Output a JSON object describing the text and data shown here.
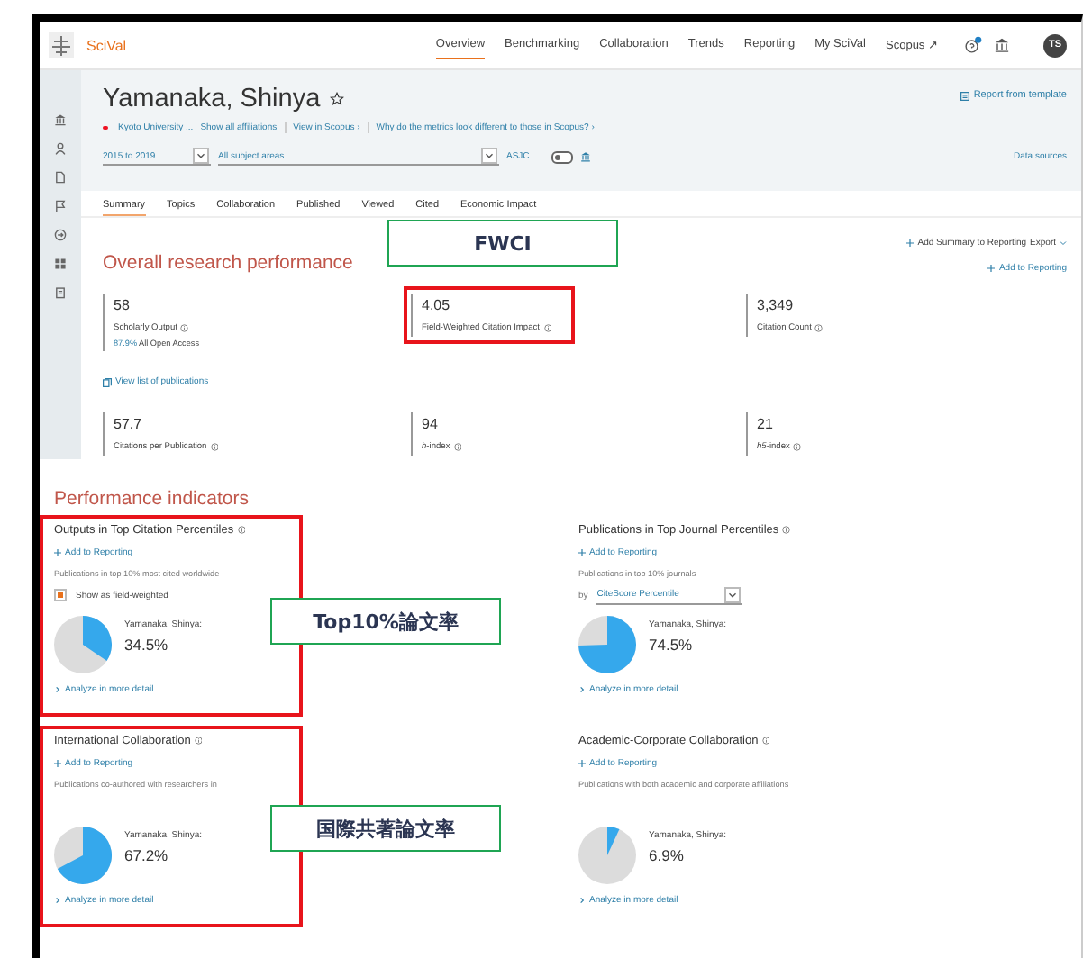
{
  "nav": {
    "logo": "SciVal",
    "items": [
      {
        "label": "Overview",
        "selected": true
      },
      {
        "label": "Benchmarking",
        "selected": false
      },
      {
        "label": "Collaboration",
        "selected": false
      },
      {
        "label": "Trends",
        "selected": false
      },
      {
        "label": "Reporting",
        "selected": false
      },
      {
        "label": "My SciVal",
        "selected": false
      },
      {
        "label": "Scopus ↗",
        "selected": false
      }
    ],
    "avatar": "TS"
  },
  "profile": {
    "name": "Yamanaka, Shinya",
    "favorite": false,
    "links": [
      "Kyoto University ...",
      "Show all affiliations",
      "View in Scopus ›",
      "Why do the metrics look different to those in Scopus? ›"
    ],
    "report": "Report from template"
  },
  "filters": {
    "years": "2015 to 2019",
    "subject": "All subject areas",
    "classification": "ASJC",
    "toggle_on": false,
    "data_sources": "Data sources"
  },
  "tabs": [
    {
      "label": "Summary",
      "selected": true
    },
    {
      "label": "Topics",
      "selected": false
    },
    {
      "label": "Collaboration",
      "selected": false
    },
    {
      "label": "Published",
      "selected": false
    },
    {
      "label": "Viewed",
      "selected": false
    },
    {
      "label": "Cited",
      "selected": false
    },
    {
      "label": "Economic Impact",
      "selected": false
    }
  ],
  "overall": {
    "title": "Overall research performance",
    "add_summary": "Add Summary to Reporting",
    "export": "Export",
    "add": "Add to Reporting",
    "view_list": "View list of publications",
    "metrics": [
      {
        "value": "58",
        "label": "Scholarly Output",
        "highlighted": false,
        "note_value": "87.9%",
        "note": "All Open Access"
      },
      {
        "value": "4.05",
        "label": "Field-Weighted Citation Impact",
        "highlighted": true
      },
      {
        "value": "3,349",
        "label": "Citation Count",
        "highlighted": false
      },
      {
        "value": "57.7",
        "label": "Citations per Publication",
        "highlighted": false
      },
      {
        "value": "94",
        "label": "*h*-index",
        "highlighted": false
      },
      {
        "value": "21",
        "label": "*h5*-index",
        "highlighted": false
      }
    ]
  },
  "indicators": {
    "title": "Performance indicators",
    "cards": [
      {
        "title": "Outputs in Top Citation Percentiles",
        "add": "Add to Reporting",
        "description": "Publications in top 10% most cited worldwide",
        "kind": "checkbox",
        "option": {
          "label": "Show as field-weighted",
          "checked": true
        },
        "entity": "Yamanaka, Shinya:",
        "value": "34.5%",
        "analyze": "Analyze in more detail",
        "highlighted": true
      },
      {
        "title": "Publications in Top Journal Percentiles",
        "add": "Add to Reporting",
        "description": "Publications in top 10% journals",
        "kind": "selector",
        "option": {
          "prefix": "by",
          "value": "CiteScore Percentile"
        },
        "entity": "Yamanaka, Shinya:",
        "value": "74.5%",
        "analyze": "Analyze in more detail",
        "highlighted": false
      },
      {
        "title": "International Collaboration",
        "add": "Add to Reporting",
        "description": "Publications co-authored with researchers in",
        "kind": "plain",
        "entity": "Yamanaka, Shinya:",
        "value": "67.2%",
        "analyze": "Analyze in more detail",
        "highlighted": true
      },
      {
        "title": "Academic-Corporate Collaboration",
        "add": "Add to Reporting",
        "description": "Publications with both academic and corporate affiliations",
        "kind": "plain",
        "entity": "Yamanaka, Shinya:",
        "value": "6.9%",
        "analyze": "Analyze in more detail",
        "highlighted": false
      }
    ]
  },
  "callouts": [
    {
      "text": "FWCI"
    },
    {
      "text": "Top10%論文率"
    },
    {
      "text": "国際共著論文率"
    }
  ]
}
